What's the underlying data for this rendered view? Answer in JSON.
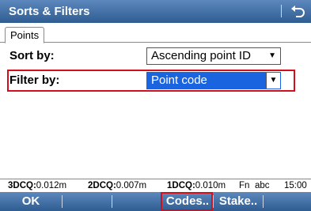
{
  "title": "Sorts & Filters",
  "tabs": [
    {
      "label": "Points"
    }
  ],
  "sort": {
    "label": "Sort by:",
    "value": "Ascending point ID"
  },
  "filter": {
    "label": "Filter by:",
    "value": "Point code"
  },
  "status": {
    "dcq3_label": "3DCQ:",
    "dcq3_value": "0.012m",
    "dcq2_label": "2DCQ:",
    "dcq2_value": "0.007m",
    "dcq1_label": "1DCQ:",
    "dcq1_value": "0.010m",
    "fn": "Fn",
    "input_mode": "abc",
    "time": "15:00"
  },
  "softkeys": {
    "ok": "OK",
    "codes": "Codes..",
    "stake": "Stake.."
  },
  "colors": {
    "title_bar": "#3f6ea3",
    "selection": "#1b64e0",
    "highlight": "#d0101c"
  }
}
